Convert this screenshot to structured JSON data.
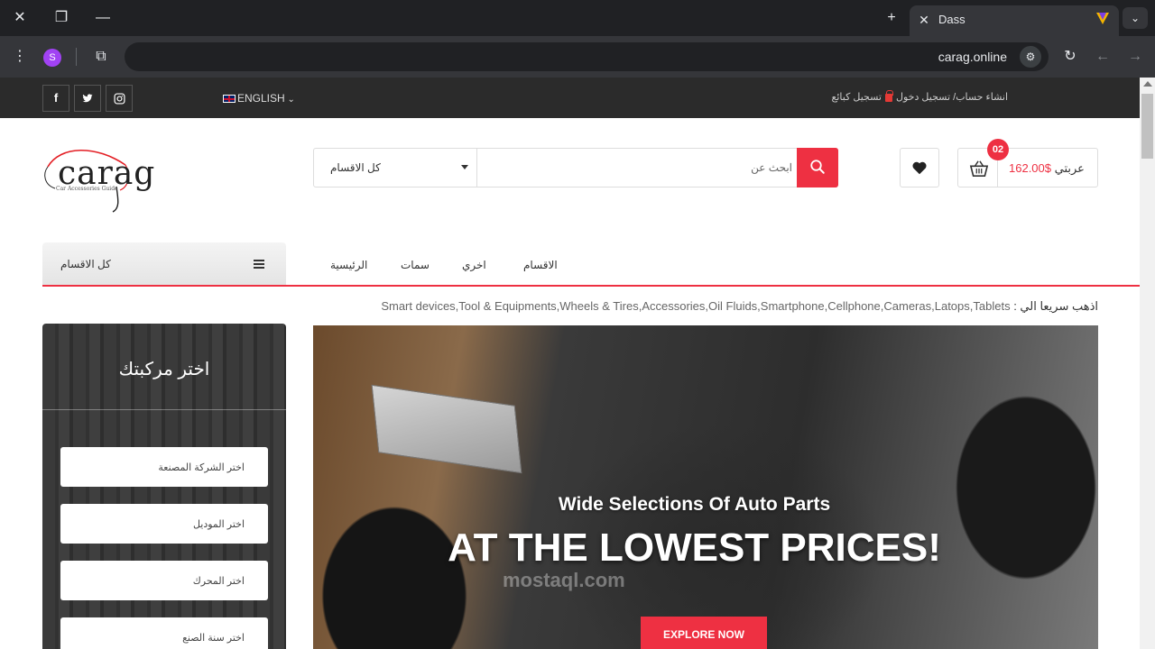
{
  "browser": {
    "tab_title": "Dass",
    "url": "carag.online",
    "profile_initial": "S"
  },
  "topbar": {
    "language": "ENGLISH",
    "account_links": "انشاء حساب/ تسجيل دخول",
    "vendor_register": "تسجيل كبائع"
  },
  "header": {
    "logo_text": "carag",
    "logo_tagline": "Car Accessories Guide",
    "search_category": "كل الاقسام",
    "search_placeholder": "ابحث عن",
    "cart_price": "$162.00",
    "cart_label": "عربتي",
    "cart_count": "02"
  },
  "nav": {
    "all_categories": "كل الاقسام",
    "links": [
      "الاقسام",
      "اخري",
      "سمات",
      "الرئيسية"
    ]
  },
  "quick_links": {
    "label": "اذهب سريعا الي :",
    "items": "Smart devices,Tool & Equipments,Wheels & Tires,Accessories,Oil Fluids,Smartphone,Cellphone,Cameras,Latops,Tablets"
  },
  "vehicle": {
    "title": "اختر مركبتك",
    "fields": [
      "اختر الشركة المصنعة",
      "اختر الموديل",
      "اختر المحرك",
      "اختر سنة الصنع"
    ]
  },
  "hero": {
    "subtitle": "Wide Selections Of Auto Parts",
    "title": "AT THE LOWEST PRICES!",
    "button": "EXPLORE NOW",
    "watermark": "mostaql.com"
  },
  "colors": {
    "accent": "#ee3042",
    "topbar": "#2b2b2b",
    "chrome": "#202124"
  }
}
